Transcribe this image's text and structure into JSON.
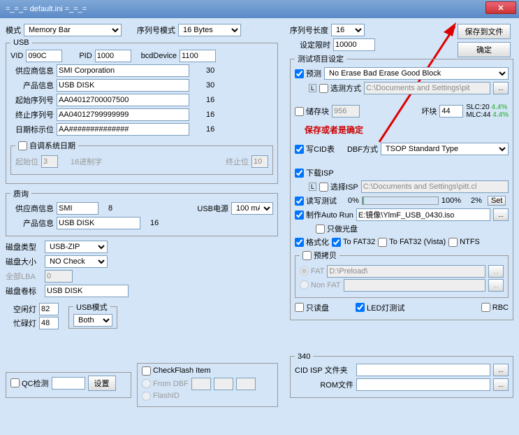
{
  "title": "=_=_=  default.ini  =_=_=",
  "btns": {
    "save": "保存到文件",
    "ok": "确定",
    "set": "设置",
    "set2": "Set",
    "browse": "..."
  },
  "labels": {
    "mode": "模式",
    "serialMode": "序列号模式",
    "serialLen": "序列号长度",
    "setLimit": "设定限时",
    "vid": "VID",
    "pid": "PID",
    "bcd": "bcdDevice",
    "vendor": "供应商信息",
    "product": "产品信息",
    "startSN": "起始序列号",
    "endSN": "终止序列号",
    "dateMark": "日期标示位",
    "autoDate": "自调系统日期",
    "startPos": "起始位",
    "hexChar": "16进制字",
    "endPos": "终止位",
    "query": "质询",
    "usbPower": "USB电源",
    "diskType": "磁盘类型",
    "diskSize": "磁盘大小",
    "allLBA": "全部LBA",
    "diskLabel": "磁盘卷标",
    "idleLed": "空闲灯",
    "busyLed": "忙碌灯",
    "usbMode": "USB模式",
    "qcCheck": "QC检测",
    "testSetting": "测试项目设定",
    "pretest": "预测",
    "selectMethod": "选测方式",
    "storage": "储存块",
    "bad": "坏块",
    "slc": "SLC:",
    "mlc": "MLC:",
    "redNote": "保存或者是确定",
    "writeCID": "写CID表",
    "dbfMode": "DBF方式",
    "downloadISP": "下载ISP",
    "selectISP": "选择ISP",
    "rwTest": "读写测试",
    "makeAutoRun": "制作Auto Run",
    "onlyCD": "只做光盘",
    "format": "格式化",
    "toFAT32": "To FAT32",
    "toFAT32V": "To FAT32 (Vista)",
    "ntfs": "NTFS",
    "precopy": "预拷贝",
    "fat": "FAT",
    "nonFAT": "Non FAT",
    "readOnly": "只读盘",
    "ledTest": "LED灯测试",
    "rbc": "RBC",
    "checkFlash": "CheckFlash Item",
    "fromDBF": "From DBF",
    "flashID": "FlashID",
    "n340": "340",
    "cidIspFolder": "CID ISP 文件夹",
    "romFile": "ROM文件"
  },
  "v": {
    "mode": "Memory Bar",
    "serialMode": "16 Bytes",
    "serialLen": "16",
    "limit": "10000",
    "vid": "090C",
    "pid": "1000",
    "bcd": "1100",
    "vendor": "SMI Corporation",
    "product": "USB DISK",
    "startSN": "AA04012700007500",
    "endSN": "AA04012799999999",
    "dateMark": "AA##############",
    "n30a": "30",
    "n30b": "30",
    "n16a": "16",
    "n16b": "16",
    "n16c": "16",
    "startPos": "3",
    "endPos": "10",
    "qVendor": "SMI",
    "q8": "8",
    "qProduct": "USB DISK",
    "q16": "16",
    "usbPower": "100 mA",
    "diskType": "USB-ZIP",
    "diskSize": "NO Check",
    "allLBA": "0",
    "diskLabel": "USB DISK",
    "idle": "82",
    "busy": "48",
    "usbMode": "Both",
    "eraseOpt": "No Erase Bad Erase Good Block",
    "selPath": "C:\\Documents and Settings\\pit",
    "storage": "956",
    "bad": "44",
    "slcVal": "20",
    "slcPct": "4.4%",
    "mlcVal": "44",
    "mlcPct": "4.4%",
    "dbfMode": "TSOP Standard Type",
    "ispPath": "C:\\Documents and Settings\\pitt.cl",
    "p0": "0%",
    "p100": "100%",
    "p2": "2%",
    "autoRunPath": "E:镜像\\YlmF_USB_0430.iso",
    "preloadPath": "D:\\Preload\\"
  }
}
